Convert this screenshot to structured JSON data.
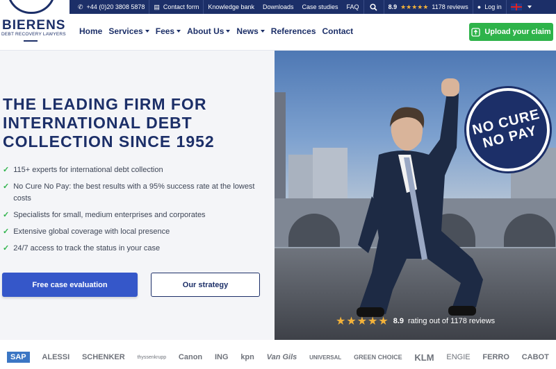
{
  "colors": {
    "brand_navy": "#1c2f68",
    "accent_green": "#2eb34a",
    "primary_blue": "#3557c9",
    "star_gold": "#f3b23a"
  },
  "logo": {
    "name": "BIERENS",
    "tagline": "DEBT RECOVERY LAWYERS"
  },
  "topbar": {
    "phone": "+44 (0)20 3808 5878",
    "contact_form": "Contact form",
    "knowledge_bank": "Knowledge bank",
    "downloads": "Downloads",
    "case_studies": "Case studies",
    "faq": "FAQ",
    "rating": "8.9",
    "reviews": "1178 reviews",
    "login": "Log in"
  },
  "nav": {
    "home": "Home",
    "services": "Services",
    "fees": "Fees",
    "about": "About Us",
    "news": "News",
    "references": "References",
    "contact": "Contact"
  },
  "upload_button": "Upload your claim",
  "hero": {
    "headline_1": "THE LEADING FIRM FOR",
    "headline_2": "INTERNATIONAL DEBT",
    "headline_3": "COLLECTION SINCE 1952",
    "bullets": [
      "115+ experts for international debt collection",
      "No Cure No Pay: the best results with a 95% success rate at the lowest costs",
      "Specialists for small, medium enterprises and corporates",
      "Extensive global coverage with local presence",
      "24/7 access to track the status in your case"
    ],
    "cta_primary": "Free case evaluation",
    "cta_secondary": "Our strategy",
    "badge_line_1": "NO CURE",
    "badge_line_2": "NO PAY",
    "rating_value": "8.9",
    "rating_text": "rating out of 1178 reviews",
    "stars": "★★★★★"
  },
  "client_logos": [
    "SAP",
    "ALESSI",
    "SCHENKER",
    "thyssenkrupp",
    "Canon",
    "ING",
    "kpn",
    "Van Gils",
    "UNIVERSAL",
    "GREEN CHOICE",
    "KLM",
    "ENGIE",
    "FERRO",
    "CABOT"
  ]
}
